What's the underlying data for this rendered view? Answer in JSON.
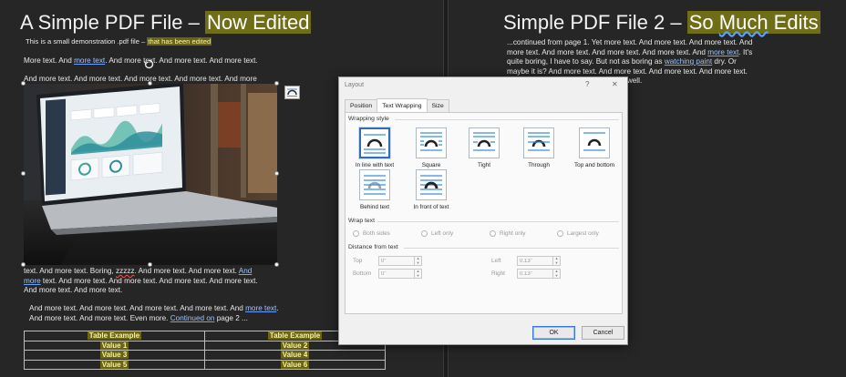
{
  "left_page": {
    "title_plain": "A Simple PDF File – ",
    "title_highlight": "Now Edited",
    "subtitle_plain": "This is a small demonstration .pdf file – ",
    "subtitle_highlight": "that has been edited",
    "line1_a": "More text. And ",
    "line1_link": "more  text",
    "line1_b": ". And more text. And more text. And more text.",
    "line2": "And more text. And more text. And more text. And more text. And more",
    "para_a": "text. And more text. Boring, ",
    "para_squiggle": "zzzzz",
    "para_b": ". And more text. And more text. ",
    "para_link1": "And more",
    "para_c": " text. And more text. And more text. And more text. And more text. And more text. And more text.",
    "para2_a": "And more text. And more text. And more text. And more text. And ",
    "para2_link1": "more text",
    "para2_b": ". And more text. And more text. Even more. ",
    "para2_link2": "Continued on",
    "para2_c": " page 2 ...",
    "table": {
      "rows": [
        [
          "Table Example",
          "Table Example"
        ],
        [
          "Value 1",
          "Value 2"
        ],
        [
          "Value 3",
          "Value 4"
        ],
        [
          "Value 5",
          "Value 6"
        ]
      ]
    }
  },
  "right_page": {
    "title_plain": "Simple PDF File 2 – ",
    "title_highlight_a": "So ",
    "title_highlight_b": "Much",
    "title_highlight_c": " Edits",
    "body_a": "...continued from page 1. Yet more text. And more text. And more text. And more text. And more text. And more text. And more text. And ",
    "body_link1": "more text",
    "body_b": ". It's quite boring, I have to say. But not as boring as ",
    "body_link2": "watching  paint",
    "body_c": " dry. Or maybe it is? And more text. And more text. And more text. And more text. And more text. The end, and just as well."
  },
  "dialog": {
    "title": "Layout",
    "help": "?",
    "close": "✕",
    "tabs": [
      "Position",
      "Text Wrapping",
      "Size"
    ],
    "active_tab": "Text Wrapping",
    "wrapping_style_label": "Wrapping style",
    "wrap_options": [
      {
        "label": "In line with text",
        "icon": "wrap-inline-icon",
        "selected": true
      },
      {
        "label": "Square",
        "icon": "wrap-square-icon",
        "selected": false
      },
      {
        "label": "Tight",
        "icon": "wrap-tight-icon",
        "selected": false
      },
      {
        "label": "Through",
        "icon": "wrap-through-icon",
        "selected": false
      },
      {
        "label": "Top and bottom",
        "icon": "wrap-top-bottom-icon",
        "selected": false
      },
      {
        "label": "Behind text",
        "icon": "wrap-behind-icon",
        "selected": false
      },
      {
        "label": "In front of text",
        "icon": "wrap-front-icon",
        "selected": false
      }
    ],
    "wrap_text_label": "Wrap text",
    "wrap_text_options": [
      "Both sides",
      "Left only",
      "Right only",
      "Largest only"
    ],
    "distance_label": "Distance from text",
    "distance": {
      "top_label": "Top",
      "top_value": "0\"",
      "bottom_label": "Bottom",
      "bottom_value": "0\"",
      "left_label": "Left",
      "left_value": "0.13\"",
      "right_label": "Right",
      "right_value": "0.13\""
    },
    "ok_label": "OK",
    "cancel_label": "Cancel"
  },
  "colors": {
    "background": "#262626",
    "highlight": "#706d17",
    "dialog_bg": "#f0f0f0",
    "accent": "#2f6db7"
  }
}
